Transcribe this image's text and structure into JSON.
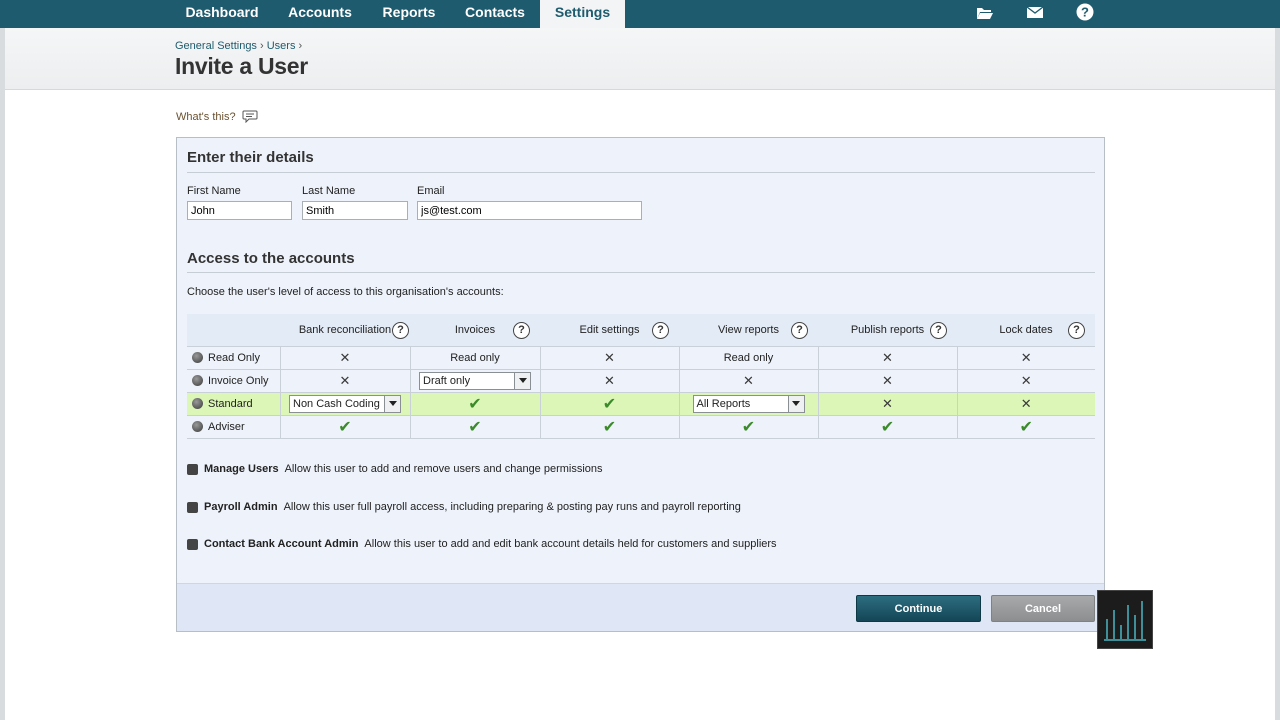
{
  "nav": {
    "items": [
      "Dashboard",
      "Accounts",
      "Reports",
      "Contacts",
      "Settings"
    ],
    "active": "Settings",
    "icons": [
      "folder-icon",
      "mail-icon",
      "help-icon"
    ]
  },
  "breadcrumb": {
    "general_settings": "General Settings",
    "users": "Users",
    "sep": "›"
  },
  "page": {
    "title": "Invite a User",
    "whats_this": "What's this?"
  },
  "details": {
    "title": "Enter their details",
    "first_name_label": "First Name",
    "first_name_value": "John",
    "last_name_label": "Last Name",
    "last_name_value": "Smith",
    "email_label": "Email",
    "email_value": "js@test.com"
  },
  "access": {
    "title": "Access to the accounts",
    "intro": "Choose the user's level of access to this organisation's accounts:",
    "columns": [
      "Bank reconciliation",
      "Invoices",
      "Edit settings",
      "View reports",
      "Publish reports",
      "Lock dates"
    ],
    "rows": [
      {
        "label": "Read Only",
        "selected": false,
        "cells": [
          "✕",
          "Read only",
          "✕",
          "Read only",
          "✕",
          "✕"
        ]
      },
      {
        "label": "Invoice Only",
        "selected": false,
        "cells": [
          "✕",
          "Draft only",
          "✕",
          "✕",
          "✕",
          "✕"
        ]
      },
      {
        "label": "Standard",
        "selected": true,
        "cells": [
          "Non Cash Coding",
          "✔",
          "✔",
          "All Reports",
          "✕",
          "✕"
        ]
      },
      {
        "label": "Adviser",
        "selected": false,
        "cells": [
          "✔",
          "✔",
          "✔",
          "✔",
          "✔",
          "✔"
        ]
      }
    ],
    "dropdowns": {
      "invoice_only_invoices": "Draft only",
      "standard_bank": "Non Cash Coding",
      "standard_reports": "All Reports"
    }
  },
  "permissions": [
    {
      "name": "Manage Users",
      "desc": "Allow this user to add and remove users and change permissions"
    },
    {
      "name": "Payroll Admin",
      "desc": "Allow this user full payroll access, including preparing & posting pay runs and payroll reporting"
    },
    {
      "name": "Contact Bank Account Admin",
      "desc": "Allow this user to add and edit bank account details held for customers and suppliers"
    }
  ],
  "buttons": {
    "continue": "Continue",
    "cancel": "Cancel"
  },
  "colors": {
    "nav_bg": "#1e5b6e",
    "highlight_row": "#dcf6b8",
    "panel_bg": "#eef3fb",
    "tick": "#3b8b2a"
  }
}
